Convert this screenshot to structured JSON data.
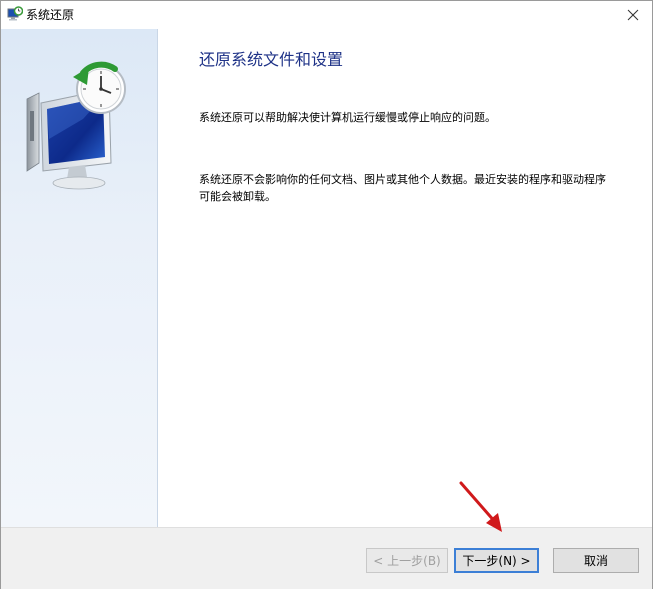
{
  "window": {
    "title": "系统还原"
  },
  "content": {
    "heading": "还原系统文件和设置",
    "paragraph1": "系统还原可以帮助解决使计算机运行缓慢或停止响应的问题。",
    "paragraph2": "系统还原不会影响你的任何文档、图片或其他个人数据。最近安装的程序和驱动程序可能会被卸载。"
  },
  "buttons": {
    "back": "< 上一步(B)",
    "next": "下一步(N) >",
    "cancel": "取消"
  },
  "icons": {
    "title": "system-restore-icon",
    "close": "close-icon",
    "hero": "monitor-clock-restore-icon",
    "annotation": "red-arrow-icon"
  },
  "colors": {
    "heading": "#1e3287",
    "focus_border": "#3c7fd6",
    "arrow": "#d0191b"
  }
}
